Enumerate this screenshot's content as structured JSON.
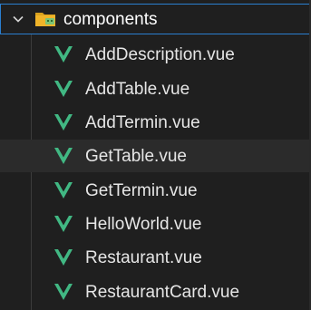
{
  "folder": {
    "name": "components",
    "expanded": true,
    "icon": "folder-components-icon",
    "icon_color": "#f0b429",
    "icon_accent": "#7cc576"
  },
  "files": [
    {
      "name": "AddDescription.vue",
      "icon": "vue-icon"
    },
    {
      "name": "AddTable.vue",
      "icon": "vue-icon"
    },
    {
      "name": "AddTermin.vue",
      "icon": "vue-icon"
    },
    {
      "name": "GetTable.vue",
      "icon": "vue-icon",
      "hovered": true
    },
    {
      "name": "GetTermin.vue",
      "icon": "vue-icon"
    },
    {
      "name": "HelloWorld.vue",
      "icon": "vue-icon"
    },
    {
      "name": "Restaurant.vue",
      "icon": "vue-icon"
    },
    {
      "name": "RestaurantCard.vue",
      "icon": "vue-icon"
    }
  ],
  "colors": {
    "background": "#1f1f1f",
    "hover": "#2b2b2b",
    "focus_border": "#2a7fd0",
    "vue_green": "#41b883",
    "text": "#e6e6e6"
  }
}
